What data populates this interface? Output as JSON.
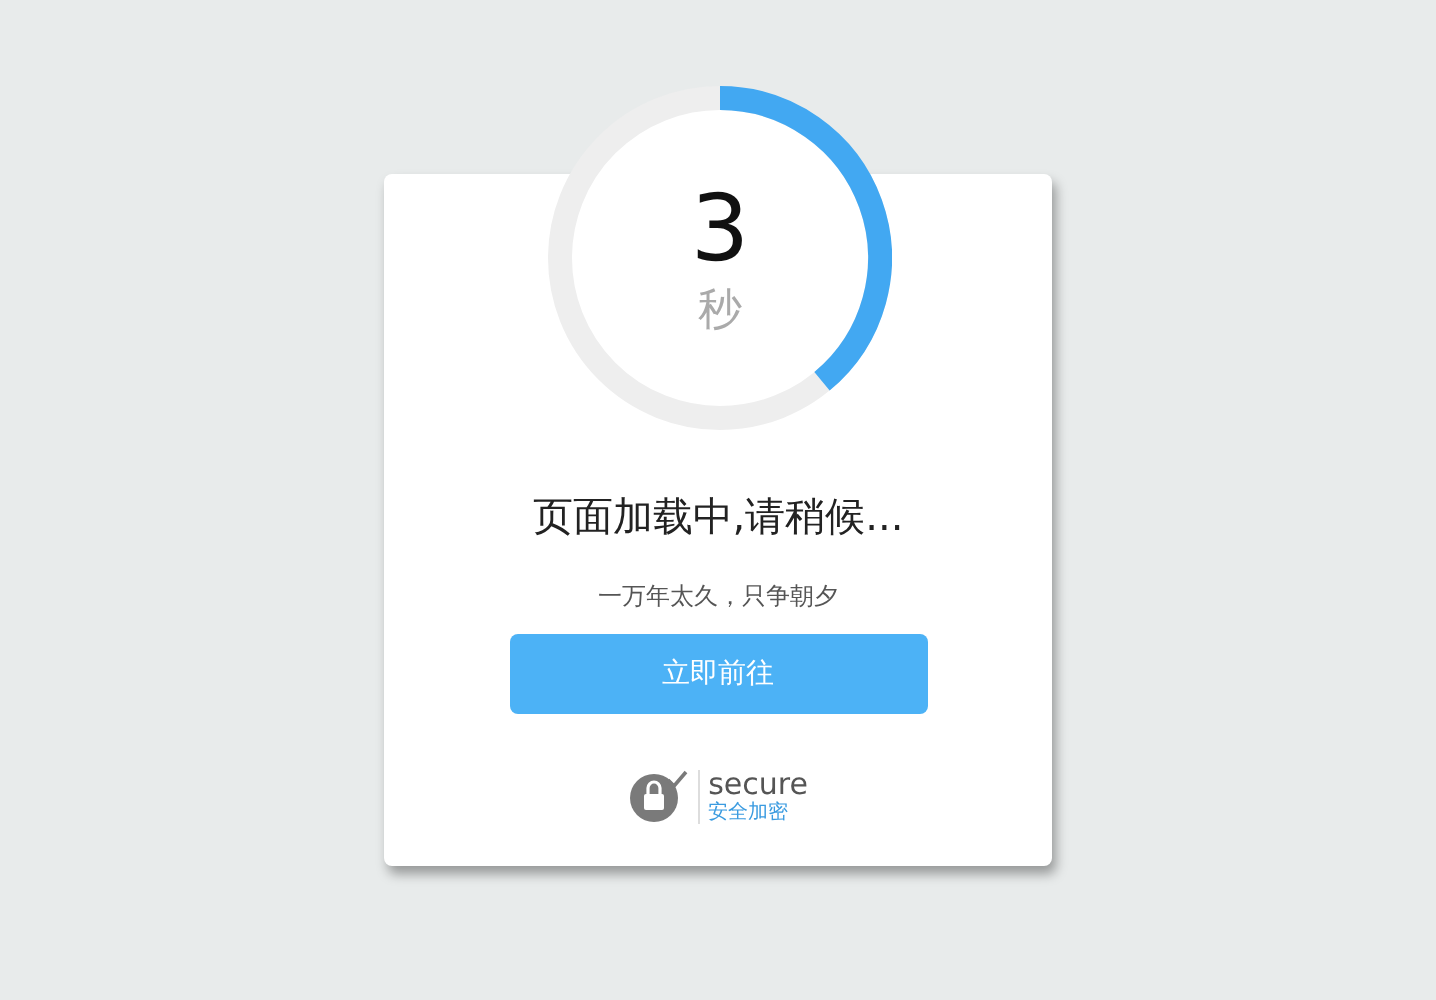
{
  "countdown": {
    "number": "3",
    "unit": "秒"
  },
  "heading": "页面加载中,请稍候...",
  "subtitle": "一万年太久，只争朝夕",
  "button": "立即前往",
  "secure": {
    "title": "secure",
    "subtitle": "安全加密"
  }
}
